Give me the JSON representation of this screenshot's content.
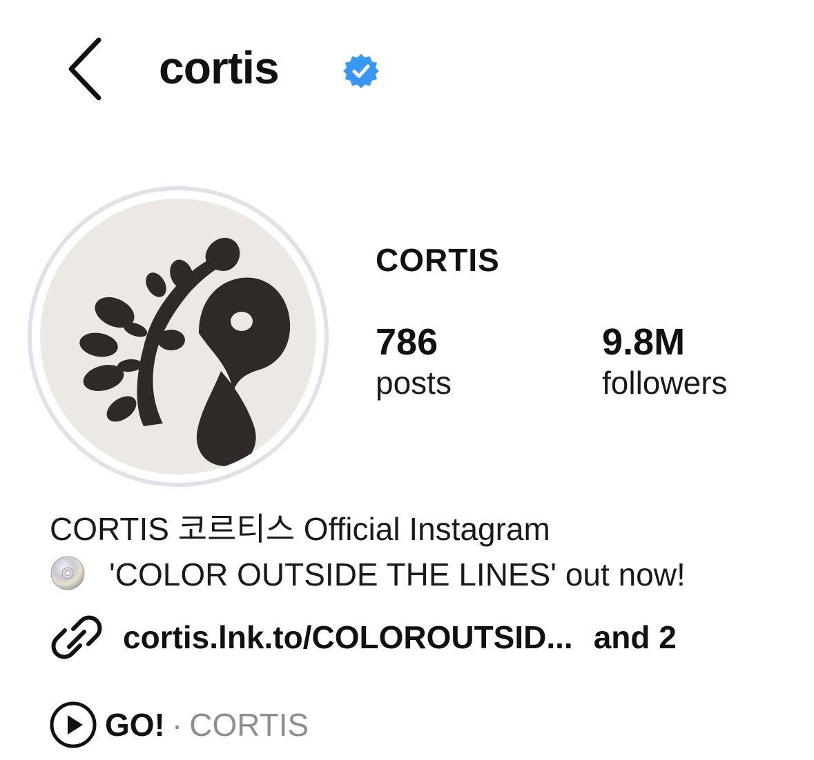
{
  "header": {
    "username": "cortis",
    "verified": true,
    "verified_color": "#3897f0"
  },
  "profile": {
    "display_name": "CORTIS",
    "stats": {
      "posts": {
        "value": "786",
        "label": "posts"
      },
      "followers": {
        "value": "9.8M",
        "label": "followers"
      }
    }
  },
  "bio": {
    "line1": "CORTIS 코르티스 Official Instagram",
    "line2_icon": "cd-icon",
    "line2": "'COLOR OUTSIDE THE LINES' out now!"
  },
  "link": {
    "icon": "link-icon",
    "text": "cortis.lnk.to/COLOROUTSID...",
    "more": "and 2"
  },
  "music": {
    "icon": "play-circle-icon",
    "title": "GO!",
    "separator": "·",
    "artist": "CORTIS"
  }
}
